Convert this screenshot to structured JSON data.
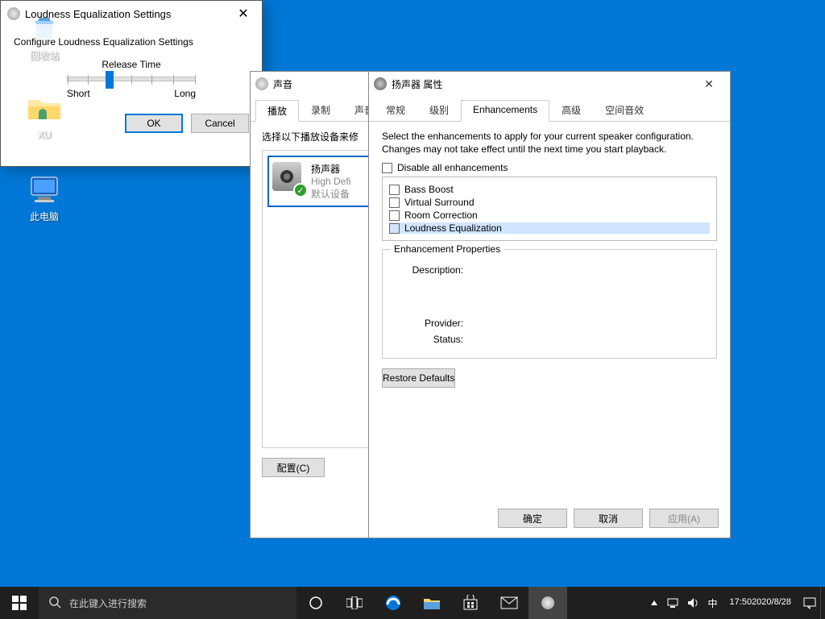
{
  "desktop": {
    "icons": [
      "回收站",
      "XU",
      "此电脑"
    ]
  },
  "sound_window": {
    "title": "声音",
    "tabs": [
      "播放",
      "录制",
      "声音"
    ],
    "instruction": "选择以下播放设备来修",
    "device": {
      "name": "扬声器",
      "subtitle": "High Defi",
      "status": "默认设备"
    },
    "configure_btn": "配置(C)"
  },
  "props_window": {
    "title": "扬声器 属性",
    "tabs": [
      "常规",
      "级别",
      "Enhancements",
      "高级",
      "空间音效"
    ],
    "description": "Select the enhancements to apply for your current speaker configuration. Changes may not take effect until the next time you start playback.",
    "disable_all": "Disable all enhancements",
    "enhancements": [
      "Bass Boost",
      "Virtual Surround",
      "Room Correction",
      "Loudness Equalization"
    ],
    "group_title": "Enhancement Properties",
    "prop_keys": {
      "description": "Description:",
      "provider": "Provider:",
      "status": "Status:"
    },
    "restore_btn": "Restore Defaults",
    "btns": {
      "ok": "确定",
      "cancel": "取消",
      "apply": "应用(A)"
    }
  },
  "loudness_dialog": {
    "title": "Loudness Equalization Settings",
    "subtitle": "Configure Loudness Equalization Settings",
    "slider_label": "Release Time",
    "min": "Short",
    "max": "Long",
    "ok": "OK",
    "cancel": "Cancel"
  },
  "taskbar": {
    "search_placeholder": "在此键入进行搜索",
    "ime": "中",
    "time": "17:50",
    "date": "2020/8/28"
  }
}
